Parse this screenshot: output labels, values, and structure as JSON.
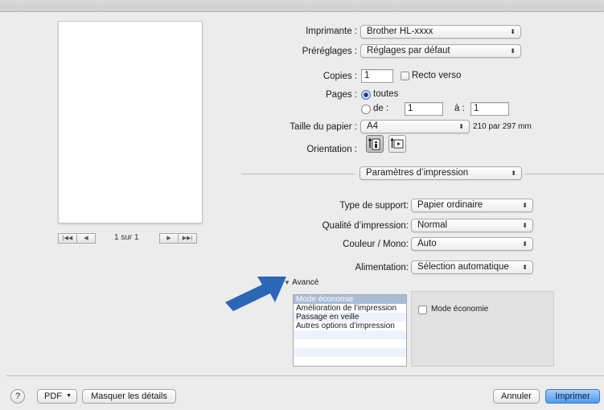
{
  "printer": {
    "label": "Imprimante :",
    "value": "Brother HL-xxxx"
  },
  "presets": {
    "label": "Préréglages :",
    "value": "Réglages par défaut"
  },
  "copies": {
    "label": "Copies :",
    "value": "1",
    "duplex_label": "Recto verso"
  },
  "pages": {
    "label": "Pages :",
    "all_label": "toutes",
    "from_label": "de :",
    "from_value": "1",
    "to_label": "à :",
    "to_value": "1"
  },
  "paper": {
    "label": "Taille du papier :",
    "value": "A4",
    "size_text": "210 par 297 mm"
  },
  "orientation": {
    "label": "Orientation :"
  },
  "section": {
    "value": "Paramètres d’impression"
  },
  "media": {
    "label": "Type de support:",
    "value": "Papier ordinaire"
  },
  "quality": {
    "label": "Qualité d’impression:",
    "value": "Normal"
  },
  "color": {
    "label": "Couleur / Mono:",
    "value": "Auto"
  },
  "source": {
    "label": "Alimentation:",
    "value": "Sélection automatique"
  },
  "advanced": {
    "label": "Avancé",
    "items": [
      "Mode économie",
      "Amélioration de l’impression",
      "Passage en veille",
      "Autres options d’impression"
    ],
    "detail_check_label": "Mode économie"
  },
  "preview": {
    "page_counter": "1 sur 1"
  },
  "footer": {
    "help": "?",
    "pdf": "PDF",
    "hide_details": "Masquer les détails",
    "cancel": "Annuler",
    "print": "Imprimer"
  }
}
